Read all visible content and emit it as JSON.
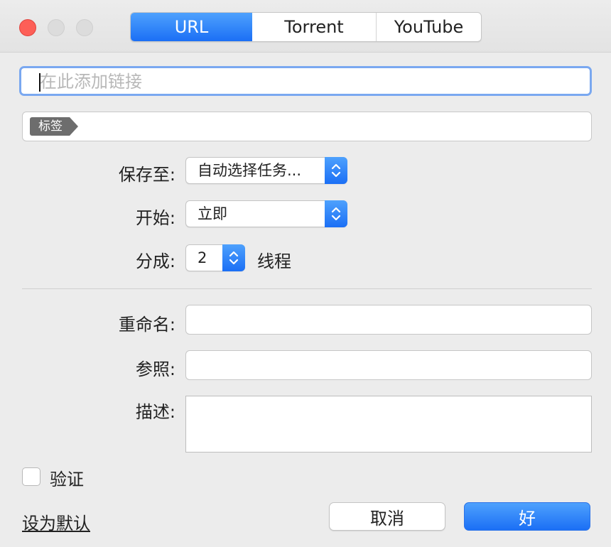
{
  "window": {
    "traffic_lights": [
      "close",
      "minimize",
      "zoom"
    ]
  },
  "tabs": [
    {
      "label": "URL",
      "active": true
    },
    {
      "label": "Torrent",
      "active": false
    },
    {
      "label": "YouTube",
      "active": false
    }
  ],
  "url_input": {
    "placeholder": "在此添加链接",
    "value": ""
  },
  "tags": {
    "chip_label": "标签"
  },
  "save_to": {
    "label": "保存至:",
    "value": "自动选择任务..."
  },
  "start": {
    "label": "开始:",
    "value": "立即"
  },
  "split": {
    "label": "分成:",
    "value": "2",
    "unit": "线程"
  },
  "rename": {
    "label": "重命名:",
    "value": ""
  },
  "referer": {
    "label": "参照:",
    "value": ""
  },
  "description": {
    "label": "描述:",
    "value": ""
  },
  "verify": {
    "label": "验证",
    "checked": false
  },
  "set_default": {
    "label": "设为默认"
  },
  "buttons": {
    "cancel": "取消",
    "ok": "好"
  },
  "colors": {
    "accent": "#1b6ff5",
    "close": "#fd5f57",
    "focus_ring": "#7aa8f0"
  }
}
